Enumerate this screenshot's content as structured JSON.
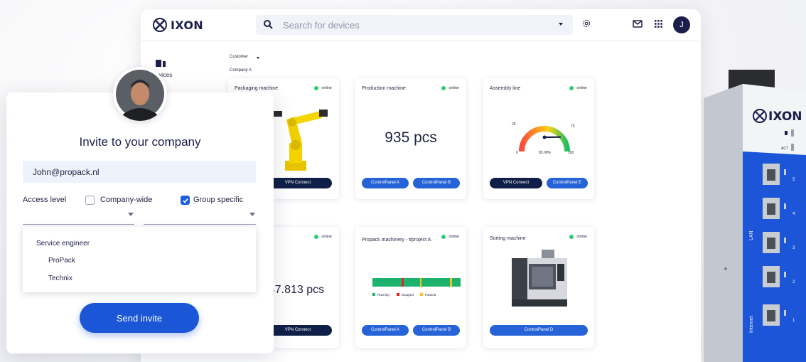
{
  "topbar": {
    "logo_text": "IXON",
    "search_placeholder": "Search for devices",
    "avatar_initial": "J"
  },
  "sidebar": {
    "devices_label": "vices"
  },
  "breadcrumb": {
    "customer_label": "Customer",
    "company_label": "Company A"
  },
  "cards": [
    {
      "title": "Packaging machine",
      "status": "online",
      "buttons": [
        "VPN Connect"
      ]
    },
    {
      "title": "Production machine",
      "status": "online",
      "value": "935 pcs",
      "buttons": [
        "ControlPanel A",
        "ControlPanel B"
      ]
    },
    {
      "title": "Assembly line",
      "status": "online",
      "gauge": {
        "value_pct": 83.0,
        "value_label": "83.00%",
        "ticks": [
          "0",
          "25",
          "75",
          "100"
        ]
      },
      "buttons": [
        "VPN Connect",
        "ControlPanel E"
      ]
    },
    {
      "title": "",
      "status": "online",
      "value": "47.813 pcs",
      "buttons": [
        "VPN Connect"
      ]
    },
    {
      "title": "Propack machinery - #project A",
      "status": "online",
      "legend": [
        "Running",
        "Stopped",
        "Paused"
      ],
      "buttons": [
        "ControlPanel A",
        "ControlPanel B"
      ]
    },
    {
      "title": "Sorting machine",
      "status": "online",
      "buttons": [
        "ControlPanel D"
      ]
    }
  ],
  "invite": {
    "title": "Invite to your company",
    "email_value": "John@propack.nl",
    "access_label": "Access level",
    "option_company_wide": "Company-wide",
    "option_group_specific": "Group specific",
    "company_wide_checked": false,
    "group_specific_checked": true,
    "dropdown_header": "Service engineer",
    "dropdown_items": [
      "ProPack",
      "Technix"
    ],
    "send_label": "Send invite"
  },
  "device": {
    "logo_text": "IXON",
    "act_label": "ACT",
    "lan_label": "LAN",
    "internet_label": "Internet",
    "ports": [
      "5",
      "4",
      "3",
      "2",
      "1"
    ]
  },
  "colors": {
    "accent_blue": "#2563d6",
    "navy": "#0f1f47",
    "online_green": "#2ecc71",
    "running": "#1db26d",
    "stopped": "#e02424",
    "paused": "#f5c518"
  }
}
